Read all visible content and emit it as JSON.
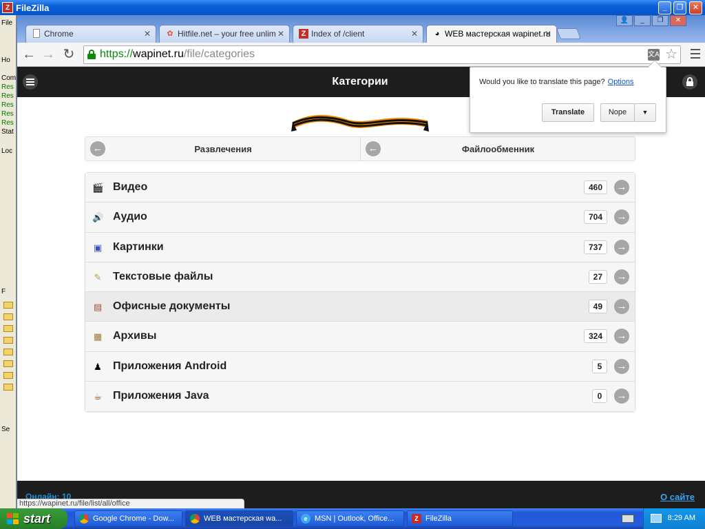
{
  "filezilla": {
    "title": "FileZilla",
    "side_lines": [
      "File",
      "Ho",
      "Com",
      "Res",
      "Res",
      "Res",
      "Res",
      "Res",
      "Stat",
      "Loc",
      "F",
      "Se"
    ]
  },
  "chrome": {
    "tabs": [
      {
        "title": "Chrome",
        "icon": "page-icon"
      },
      {
        "title": "Hitfile.net – your free unlim",
        "icon": "hitfile-icon"
      },
      {
        "title": "Index of /client",
        "icon": "filezilla-icon"
      },
      {
        "title": "WEB мастерская wapinet.ru",
        "icon": "wapinet-icon"
      }
    ],
    "url": {
      "scheme": "https://",
      "host": "wapinet.ru",
      "path": "/file/categories"
    }
  },
  "translate": {
    "question": "Would you like to translate this page?",
    "options": "Options",
    "translate_btn": "Translate",
    "nope_btn": "Nope",
    "dropdown": "▼"
  },
  "site": {
    "title": "Категории",
    "nav": [
      {
        "label": "Развлечения"
      },
      {
        "label": "Файлообменник"
      }
    ],
    "categories": [
      {
        "name": "Видео",
        "count": "460",
        "icon": "video-icon",
        "glyph": "🎬"
      },
      {
        "name": "Аудио",
        "count": "704",
        "icon": "audio-icon",
        "glyph": "🔊"
      },
      {
        "name": "Картинки",
        "count": "737",
        "icon": "image-icon",
        "glyph": "▣"
      },
      {
        "name": "Текстовые файлы",
        "count": "27",
        "icon": "text-file-icon",
        "glyph": "✎"
      },
      {
        "name": "Офисные документы",
        "count": "49",
        "icon": "office-doc-icon",
        "glyph": "▤"
      },
      {
        "name": "Архивы",
        "count": "324",
        "icon": "archive-icon",
        "glyph": "▦"
      },
      {
        "name": "Приложения Android",
        "count": "5",
        "icon": "android-icon",
        "glyph": "♟"
      },
      {
        "name": "Приложения Java",
        "count": "0",
        "icon": "java-icon",
        "glyph": "☕"
      }
    ],
    "footer_online": "Онлайн: 10",
    "footer_about": "О сайте",
    "status_url": "https://wapinet.ru/file/list/all/office"
  },
  "taskbar": {
    "start": "start",
    "tasks": [
      {
        "label": "Google Chrome - Dow...",
        "icon": "chrome-icon"
      },
      {
        "label": "WEB мастерская wa...",
        "icon": "chrome-icon"
      },
      {
        "label": "MSN | Outlook, Office...",
        "icon": "ie-icon"
      },
      {
        "label": "FileZilla",
        "icon": "filezilla-icon"
      }
    ],
    "clock": "8:29 AM"
  },
  "colors": {
    "header_bg": "#1d1d1d",
    "link_blue": "#36a5ef",
    "secure_green": "#0a8a0a"
  }
}
